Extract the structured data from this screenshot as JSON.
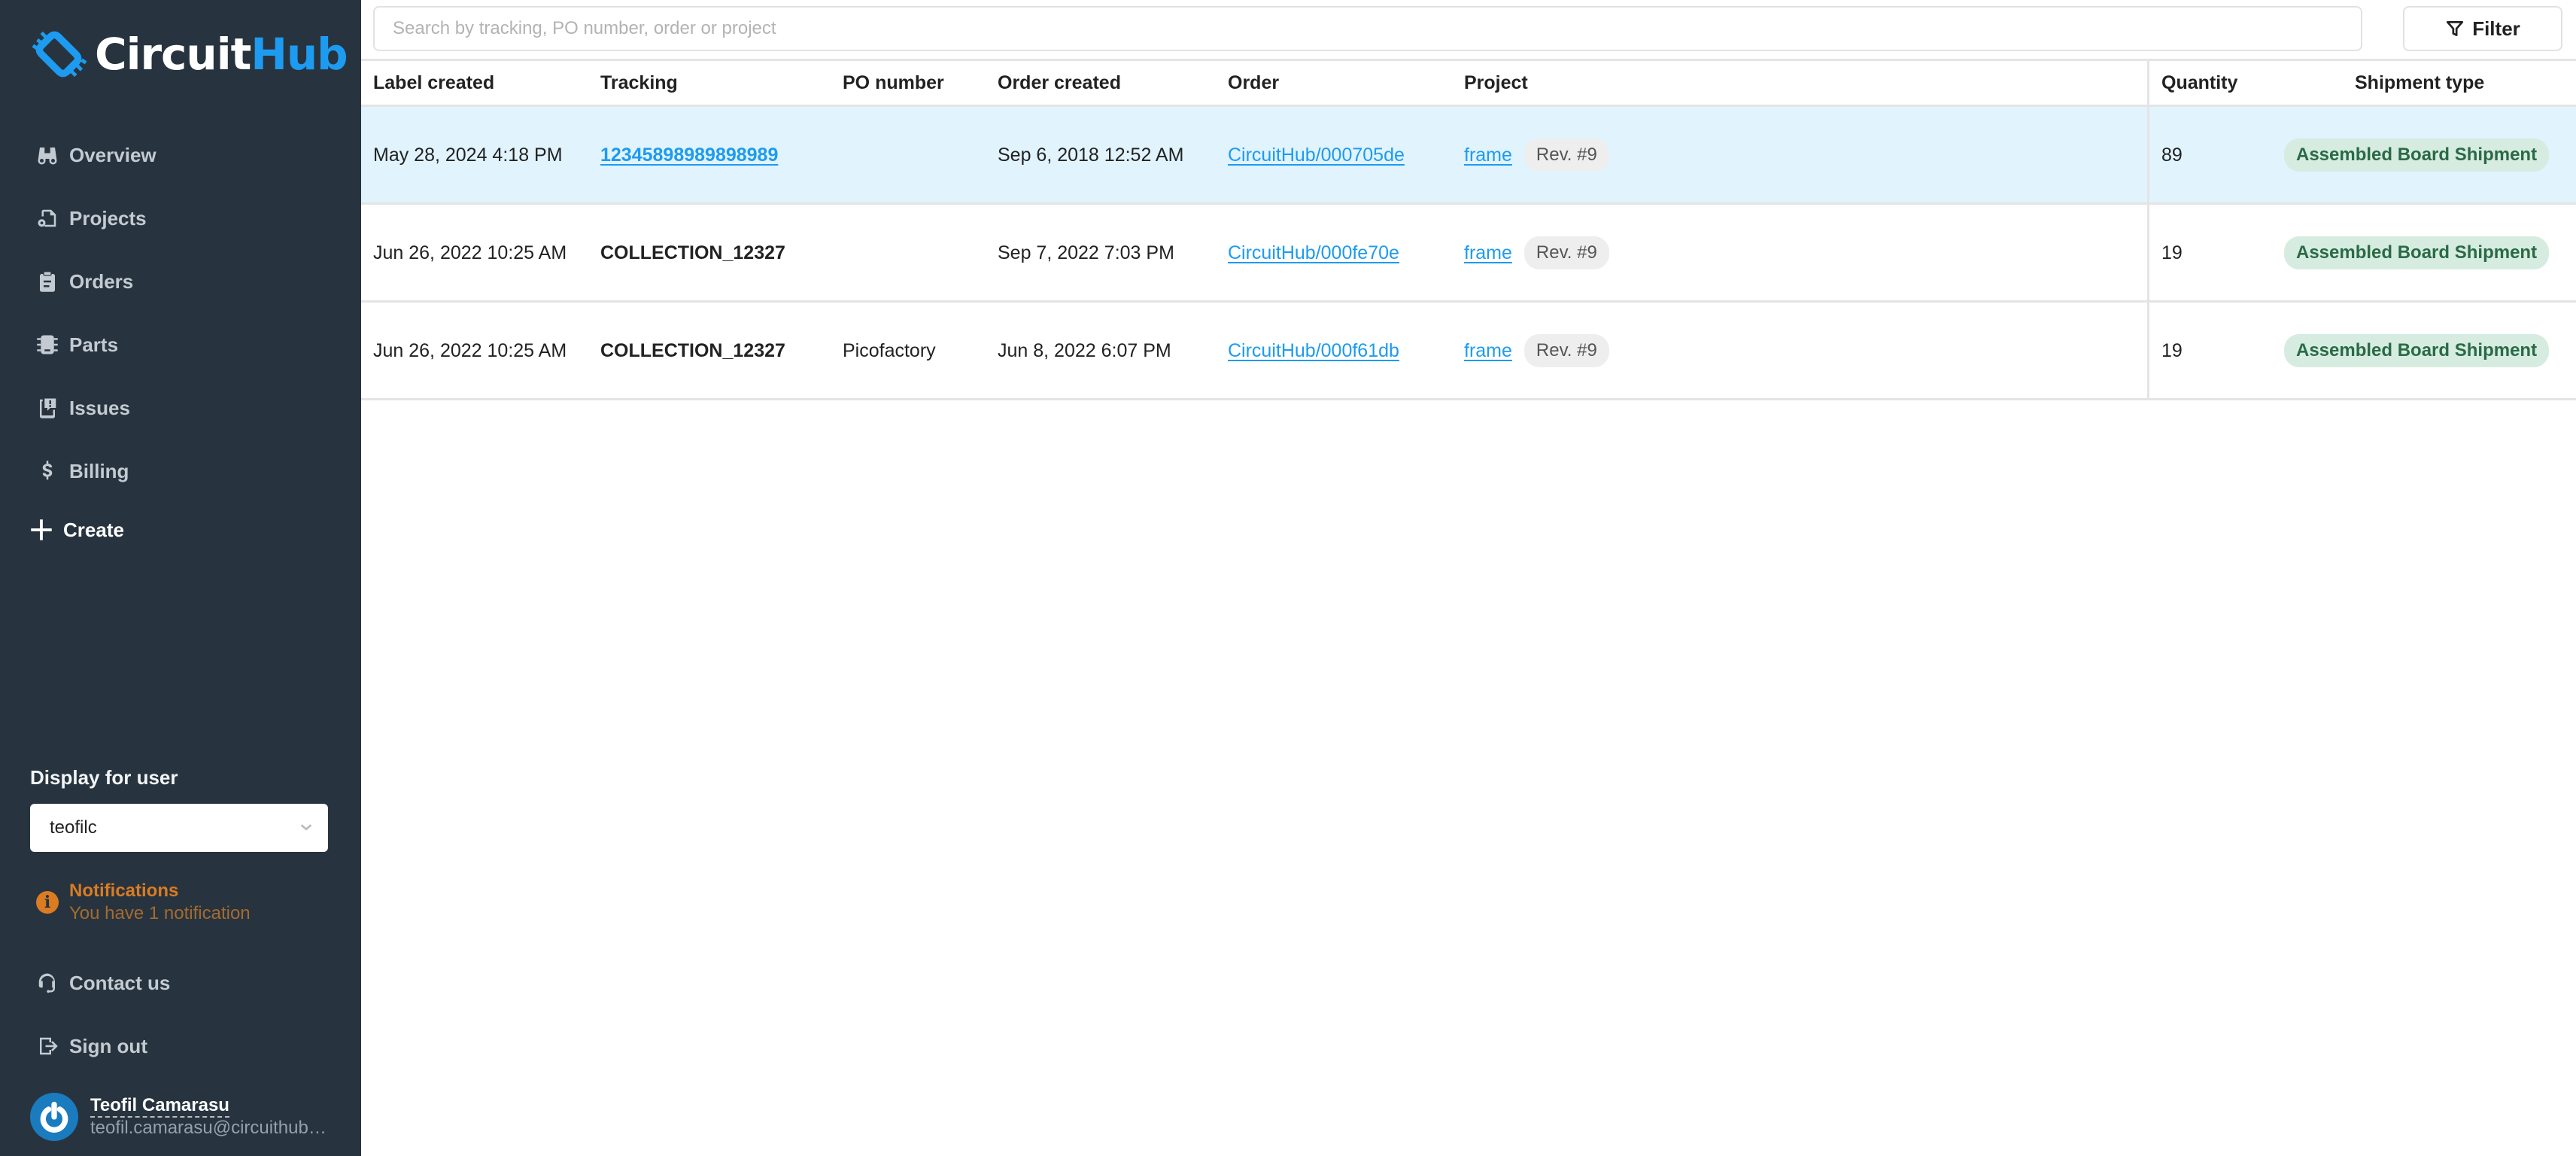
{
  "app": {
    "brand_part1": "Circuit",
    "brand_part2": "Hub",
    "colors": {
      "sidebar_bg": "#27343f",
      "accent": "#1d9bf0",
      "selected_row": "#e1f3fd",
      "notification": "#db7b22",
      "shipment_badge_bg": "#d6ece0",
      "shipment_badge_text": "#2a6a46"
    }
  },
  "sidebar": {
    "nav": [
      {
        "label": "Overview",
        "icon": "binoculars-icon"
      },
      {
        "label": "Projects",
        "icon": "project-gear-icon"
      },
      {
        "label": "Orders",
        "icon": "clipboard-icon"
      },
      {
        "label": "Parts",
        "icon": "chip-icon"
      },
      {
        "label": "Issues",
        "icon": "issue-icon"
      },
      {
        "label": "Billing",
        "icon": "dollar-icon"
      }
    ],
    "create_label": "Create",
    "display_for_user_label": "Display for user",
    "selected_user": "teofilc",
    "notifications": {
      "title": "Notifications",
      "message": "You have 1 notification"
    },
    "contact_label": "Contact us",
    "signout_label": "Sign out",
    "user": {
      "name": "Teofil Camarasu",
      "email": "teofil.camarasu@circuithub.com"
    }
  },
  "toolbar": {
    "search_placeholder": "Search by tracking, PO number, order or project",
    "search_value": "",
    "filter_label": "Filter"
  },
  "table": {
    "columns": [
      "Label created",
      "Tracking",
      "PO number",
      "Order created",
      "Order",
      "Project",
      "Quantity",
      "Shipment type"
    ],
    "rows": [
      {
        "label_created": "May 28, 2024 4:18 PM",
        "tracking": "12345898989898989",
        "tracking_is_link": true,
        "po_number": "",
        "order_created": "Sep 6, 2018 12:52 AM",
        "order": "CircuitHub/000705de",
        "project": "frame",
        "revision": "Rev. #9",
        "quantity": "89",
        "shipment_type": "Assembled Board Shipment",
        "selected": true
      },
      {
        "label_created": "Jun 26, 2022 10:25 AM",
        "tracking": "COLLECTION_12327",
        "tracking_is_link": false,
        "po_number": "",
        "order_created": "Sep 7, 2022 7:03 PM",
        "order": "CircuitHub/000fe70e",
        "project": "frame",
        "revision": "Rev. #9",
        "quantity": "19",
        "shipment_type": "Assembled Board Shipment",
        "selected": false
      },
      {
        "label_created": "Jun 26, 2022 10:25 AM",
        "tracking": "COLLECTION_12327",
        "tracking_is_link": false,
        "po_number": "Picofactory",
        "order_created": "Jun 8, 2022 6:07 PM",
        "order": "CircuitHub/000f61db",
        "project": "frame",
        "revision": "Rev. #9",
        "quantity": "19",
        "shipment_type": "Assembled Board Shipment",
        "selected": false
      }
    ]
  }
}
